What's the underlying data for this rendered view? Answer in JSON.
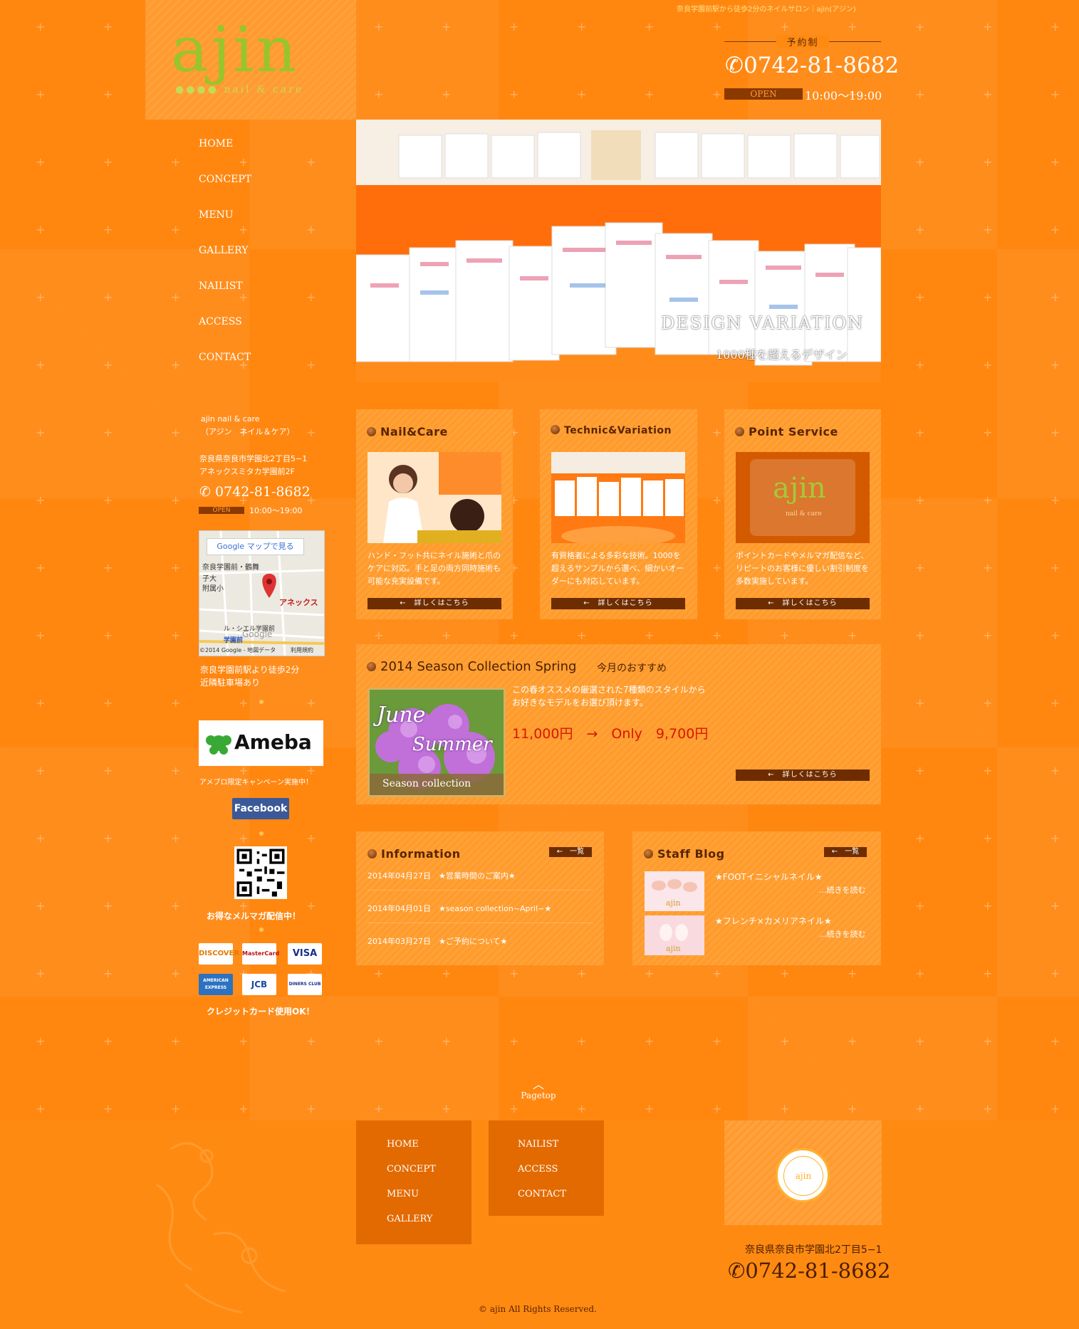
{
  "header": {
    "tagline": "奈良学園前駅から徒歩2分のネイルサロン｜ajin(アジン)",
    "logo": "ajin",
    "logo_sub": "●●●● nail & care",
    "reserve": "予約制",
    "phone": "0742-81-8682",
    "open_label": "OPEN",
    "hours": "10:00〜19:00"
  },
  "nav": [
    "HOME",
    "CONCEPT",
    "MENU",
    "GALLERY",
    "NAILIST",
    "ACCESS",
    "CONTACT"
  ],
  "hero": {
    "title": "DESIGN VARIATION",
    "subtitle": "1000種を超えるデザイン"
  },
  "sidebar": {
    "name_line1": "ajin nail & care",
    "name_line2": "（アジン　ネイル＆ケア）",
    "addr_line1": "奈良県奈良市学園北2丁目5−1",
    "addr_line2": "アネックスミタカ学園前2F",
    "phone": "0742-81-8682",
    "open_label": "OPEN",
    "hours": "10:00〜19:00",
    "map_button": "Google マップで見る",
    "map_labels": [
      "奈良学園前・鶴舞",
      "子大",
      "附属小",
      "アネックス",
      "ル・シエル学園前",
      "学園前",
      "Google",
      "©2014 Google - 地図データ",
      "利用規約"
    ],
    "walk_line1": "奈良学園前駅より徒歩2分",
    "walk_line2": "近隣駐車場あり",
    "ameba": "Ameba",
    "ameba_note": "アメブロ限定キャンペーン実施中！",
    "facebook": "Facebook",
    "mailmag": "お得なメルマガ配信中！",
    "cards": [
      "DISCOVER",
      "MasterCard",
      "VISA",
      "AMERICAN EXPRESS",
      "JCB",
      "DINERS CLUB"
    ],
    "credit_ok": "クレジットカード使用OK！"
  },
  "services": [
    {
      "title": "Nail&Care",
      "desc": "ハンド・フット共にネイル施術と爪のケアに対応。手と足の両方同時施術も可能な充実設備です。",
      "more": "←　詳しくはこちら"
    },
    {
      "title": "Technic&Variation",
      "desc": "有資格者による多彩な技術。1000を超えるサンプルから選べ、細かいオーダーにも対応しています。",
      "more": "←　詳しくはこちら"
    },
    {
      "title": "Point Service",
      "desc": "ポイントカードやメルマガ配信など、リピートのお客様に優しい割引制度を多数実施しています。",
      "more": "←　詳しくはこちら",
      "img_text": "ajin",
      "img_sub": "nail & care"
    }
  ],
  "season": {
    "title": "2014 Season Collection Spring",
    "sub": "今月のおすすめ",
    "img_line1": "June",
    "img_line2": "Summer",
    "img_line3": "Season collection",
    "desc_line1": "この春オススメの厳選された7種類のスタイルから",
    "desc_line2": "お好きなモデルをお選び頂けます。",
    "price": "11,000円　→　Only　9,700円",
    "more": "←　詳しくはこちら"
  },
  "information": {
    "title": "Information",
    "list_btn": "←　一覧",
    "rows": [
      "2014年04月27日　★営業時間のご案内★",
      "2014年04月01日　★season collection~April~★",
      "2014年03月27日　★ご予約について★"
    ]
  },
  "blog": {
    "title": "Staff Blog",
    "list_btn": "←　一覧",
    "posts": [
      {
        "title": "★FOOTイニシャルネイル★",
        "more": "...続きを読む",
        "thumb": "ajin"
      },
      {
        "title": "★フレンチ×カメリアネイル★",
        "more": "...続きを読む",
        "thumb": "ajin"
      }
    ]
  },
  "footer": {
    "pagetop": "Pagetop",
    "nav_left": [
      "HOME",
      "CONCEPT",
      "MENU",
      "GALLERY"
    ],
    "nav_right": [
      "NAILIST",
      "ACCESS",
      "CONTACT"
    ],
    "logo": "ajin",
    "address": "奈良県奈良市学園北2丁目5−1",
    "phone": "0742-81-8682",
    "copyright": "© ajin All Rights Reserved."
  },
  "colors": {
    "accent": "#ff8a12",
    "dark": "#6e2d00",
    "logo_green": "#98c52a",
    "price_red": "#d61800"
  }
}
